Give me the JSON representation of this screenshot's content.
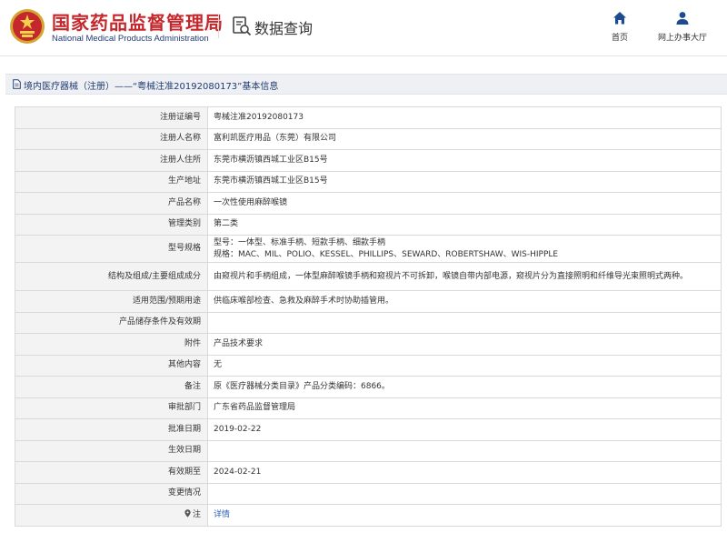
{
  "header": {
    "brand_cn": "国家药品监督管理局",
    "brand_en": "National Medical Products Administration",
    "section_title": "数据查询",
    "nav": {
      "home_label": "首页",
      "hall_label": "网上办事大厅"
    }
  },
  "titlebar": {
    "text": "境内医疗器械（注册）——“粤械注准20192080173”基本信息"
  },
  "details": {
    "reg_no": {
      "label": "注册证编号",
      "value": "粤械注准20192080173"
    },
    "registrant": {
      "label": "注册人名称",
      "value": "富利凯医疗用品（东莞）有限公司"
    },
    "registrant_addr": {
      "label": "注册人住所",
      "value": "东莞市横沥镇西城工业区B15号"
    },
    "prod_addr": {
      "label": "生产地址",
      "value": "东莞市横沥镇西城工业区B15号"
    },
    "product_name": {
      "label": "产品名称",
      "value": "一次性使用麻醉喉镜"
    },
    "mgmt_class": {
      "label": "管理类别",
      "value": "第二类"
    },
    "model_spec": {
      "label": "型号规格",
      "line1": "型号：一体型、标准手柄、短款手柄、细款手柄",
      "line2": "规格：MAC、MIL、POLIO、KESSEL、PHILLIPS、SEWARD、ROBERTSHAW、WIS-HIPPLE"
    },
    "structure": {
      "label": "结构及组成/主要组成成分",
      "value": "由窥视片和手柄组成，一体型麻醉喉镜手柄和窥视片不可拆卸，喉镜自带内部电源，窥视片分为直接照明和纤维导光束照明式两种。"
    },
    "scope": {
      "label": "适用范围/预期用途",
      "value": "供临床喉部检查、急救及麻醉手术时协助插管用。"
    },
    "storage": {
      "label": "产品储存条件及有效期",
      "value": ""
    },
    "attachment": {
      "label": "附件",
      "value": "产品技术要求"
    },
    "other": {
      "label": "其他内容",
      "value": "无"
    },
    "remark": {
      "label": "备注",
      "value": "原《医疗器械分类目录》产品分类编码：6866。"
    },
    "approval_dept": {
      "label": "审批部门",
      "value": "广东省药品监督管理局"
    },
    "approval_date": {
      "label": "批准日期",
      "value": "2019-02-22"
    },
    "effective_date": {
      "label": "生效日期",
      "value": ""
    },
    "valid_until": {
      "label": "有效期至",
      "value": "2024-02-21"
    },
    "change": {
      "label": "变更情况",
      "value": ""
    },
    "note": {
      "label": "注",
      "value": "详情"
    }
  },
  "colors": {
    "brand_red": "#c5282c",
    "brand_blue": "#223a7a",
    "title_blue": "#1e3c72",
    "link_blue": "#2a62b8",
    "label_bg": "#f3f3f3",
    "border": "#d9d9d9"
  },
  "icons": [
    "national-emblem-icon",
    "data-query-icon",
    "home-icon",
    "user-icon",
    "document-icon",
    "map-pin-icon"
  ]
}
